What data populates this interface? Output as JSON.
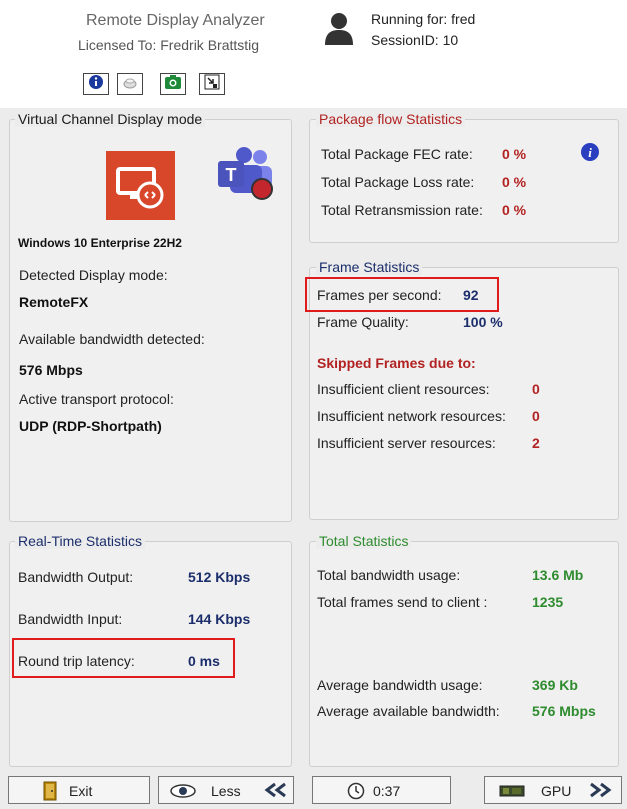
{
  "header": {
    "app_title": "Remote Display Analyzer",
    "licensed_to": "Licensed To: Fredrik Brattstig",
    "running_for": "Running for: fred",
    "session_id": "SessionID: 10"
  },
  "toolbar": {
    "icons": [
      "info-icon",
      "clear-icon",
      "camera-icon",
      "settings-icon"
    ]
  },
  "virtual_channel": {
    "title": "Virtual Channel Display mode",
    "os_name": "Windows 10 Enterprise 22H2",
    "detected_label": "Detected Display mode:",
    "detected_value": "RemoteFX",
    "bandwidth_label": "Available bandwidth detected:",
    "bandwidth_value": "576 Mbps",
    "transport_label": "Active transport protocol:",
    "transport_value": "UDP (RDP-Shortpath)"
  },
  "package_flow": {
    "title": "Package flow Statistics",
    "rows": [
      {
        "label": "Total Package FEC rate:",
        "value": "0 %"
      },
      {
        "label": "Total Package Loss rate:",
        "value": "0 %"
      },
      {
        "label": "Total Retransmission rate:",
        "value": "0 %"
      }
    ]
  },
  "frame_stats": {
    "title": "Frame Statistics",
    "fps_label": "Frames per second:",
    "fps_value": "92",
    "quality_label": "Frame Quality:",
    "quality_value": "100 %",
    "skipped_heading": "Skipped Frames due to:",
    "skipped": [
      {
        "label": "Insufficient client resources:",
        "value": "0"
      },
      {
        "label": "Insufficient network resources:",
        "value": "0"
      },
      {
        "label": "Insufficient server resources:",
        "value": "2"
      }
    ]
  },
  "realtime": {
    "title": "Real-Time Statistics",
    "output_label": "Bandwidth Output:",
    "output_value": "512 Kbps",
    "input_label": "Bandwidth Input:",
    "input_value": "144 Kbps",
    "latency_label": "Round trip latency:",
    "latency_value": "0 ms"
  },
  "total_stats": {
    "title": "Total Statistics",
    "usage_label": "Total bandwidth usage:",
    "usage_value": "13.6 Mb",
    "frames_label": "Total frames send to client :",
    "frames_value": "1235",
    "avg_usage_label": "Average bandwidth usage:",
    "avg_usage_value": "369 Kb",
    "avg_avail_label": "Average available bandwidth:",
    "avg_avail_value": "576 Mbps"
  },
  "bottom_bar": {
    "exit_label": "Exit",
    "less_label": "Less",
    "timer_label": "0:37",
    "gpu_label": "GPU"
  },
  "colors": {
    "accent_blue": "#1b2e6b",
    "value_red": "#b22222",
    "value_green": "#2e8b2e",
    "highlight_red": "#e01b1b"
  }
}
